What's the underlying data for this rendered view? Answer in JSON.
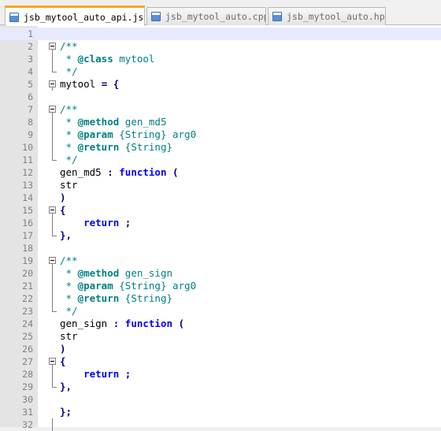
{
  "tabs": [
    {
      "label": "jsb_mytool_auto_api.js",
      "active": true,
      "close_icon": "close-icon"
    },
    {
      "label": "jsb_mytool_auto.cpp",
      "active": false
    },
    {
      "label": "jsb_mytool_auto.hpp",
      "active": false
    }
  ],
  "editor": {
    "current_line": 1,
    "lines": [
      {
        "n": "1",
        "fold": "",
        "tokens": [
          {
            "t": "",
            "c": ""
          }
        ]
      },
      {
        "n": "2",
        "fold": "open",
        "tokens": [
          {
            "t": "/**",
            "c": "c-comment"
          }
        ]
      },
      {
        "n": "3",
        "fold": "mid",
        "tokens": [
          {
            "t": " * ",
            "c": "c-comment"
          },
          {
            "t": "@class",
            "c": "c-tag"
          },
          {
            "t": " mytool",
            "c": "c-comment"
          }
        ]
      },
      {
        "n": "4",
        "fold": "end",
        "tokens": [
          {
            "t": " */",
            "c": "c-comment"
          }
        ]
      },
      {
        "n": "5",
        "fold": "open-solo",
        "tokens": [
          {
            "t": "mytool ",
            "c": ""
          },
          {
            "t": "=",
            "c": "c-op"
          },
          {
            "t": " ",
            "c": ""
          },
          {
            "t": "{",
            "c": "c-op"
          }
        ]
      },
      {
        "n": "6",
        "fold": "",
        "tokens": [
          {
            "t": "",
            "c": ""
          }
        ]
      },
      {
        "n": "7",
        "fold": "open",
        "tokens": [
          {
            "t": "/**",
            "c": "c-comment"
          }
        ]
      },
      {
        "n": "8",
        "fold": "mid",
        "tokens": [
          {
            "t": " * ",
            "c": "c-comment"
          },
          {
            "t": "@method",
            "c": "c-tag"
          },
          {
            "t": " gen_md5",
            "c": "c-comment"
          }
        ]
      },
      {
        "n": "9",
        "fold": "mid",
        "tokens": [
          {
            "t": " * ",
            "c": "c-comment"
          },
          {
            "t": "@param",
            "c": "c-tag"
          },
          {
            "t": " {String} arg0",
            "c": "c-comment"
          }
        ]
      },
      {
        "n": "10",
        "fold": "mid",
        "tokens": [
          {
            "t": " * ",
            "c": "c-comment"
          },
          {
            "t": "@return",
            "c": "c-tag"
          },
          {
            "t": " {String}",
            "c": "c-comment"
          }
        ]
      },
      {
        "n": "11",
        "fold": "end",
        "tokens": [
          {
            "t": " */",
            "c": "c-comment"
          }
        ]
      },
      {
        "n": "12",
        "fold": "",
        "tokens": [
          {
            "t": "gen_md5 ",
            "c": ""
          },
          {
            "t": ":",
            "c": "c-op"
          },
          {
            "t": " ",
            "c": ""
          },
          {
            "t": "function",
            "c": "c-kw"
          },
          {
            "t": " ",
            "c": ""
          },
          {
            "t": "(",
            "c": "c-op"
          }
        ]
      },
      {
        "n": "13",
        "fold": "",
        "tokens": [
          {
            "t": "str",
            "c": ""
          }
        ]
      },
      {
        "n": "14",
        "fold": "",
        "tokens": [
          {
            "t": ")",
            "c": "c-op"
          }
        ]
      },
      {
        "n": "15",
        "fold": "open",
        "tokens": [
          {
            "t": "{",
            "c": "c-op"
          }
        ]
      },
      {
        "n": "16",
        "fold": "mid",
        "tokens": [
          {
            "t": "    ",
            "c": ""
          },
          {
            "t": "return",
            "c": "c-kw"
          },
          {
            "t": " ",
            "c": ""
          },
          {
            "t": ";",
            "c": "c-op"
          }
        ]
      },
      {
        "n": "17",
        "fold": "end",
        "tokens": [
          {
            "t": "},",
            "c": "c-op"
          }
        ]
      },
      {
        "n": "18",
        "fold": "",
        "tokens": [
          {
            "t": "",
            "c": ""
          }
        ]
      },
      {
        "n": "19",
        "fold": "open",
        "tokens": [
          {
            "t": "/**",
            "c": "c-comment"
          }
        ]
      },
      {
        "n": "20",
        "fold": "mid",
        "tokens": [
          {
            "t": " * ",
            "c": "c-comment"
          },
          {
            "t": "@method",
            "c": "c-tag"
          },
          {
            "t": " gen_sign",
            "c": "c-comment"
          }
        ]
      },
      {
        "n": "21",
        "fold": "mid",
        "tokens": [
          {
            "t": " * ",
            "c": "c-comment"
          },
          {
            "t": "@param",
            "c": "c-tag"
          },
          {
            "t": " {String} arg0",
            "c": "c-comment"
          }
        ]
      },
      {
        "n": "22",
        "fold": "mid",
        "tokens": [
          {
            "t": " * ",
            "c": "c-comment"
          },
          {
            "t": "@return",
            "c": "c-tag"
          },
          {
            "t": " {String}",
            "c": "c-comment"
          }
        ]
      },
      {
        "n": "23",
        "fold": "end",
        "tokens": [
          {
            "t": " */",
            "c": "c-comment"
          }
        ]
      },
      {
        "n": "24",
        "fold": "",
        "tokens": [
          {
            "t": "gen_sign ",
            "c": ""
          },
          {
            "t": ":",
            "c": "c-op"
          },
          {
            "t": " ",
            "c": ""
          },
          {
            "t": "function",
            "c": "c-kw"
          },
          {
            "t": " ",
            "c": ""
          },
          {
            "t": "(",
            "c": "c-op"
          }
        ]
      },
      {
        "n": "25",
        "fold": "",
        "tokens": [
          {
            "t": "str",
            "c": ""
          }
        ]
      },
      {
        "n": "26",
        "fold": "",
        "tokens": [
          {
            "t": ")",
            "c": "c-op"
          }
        ]
      },
      {
        "n": "27",
        "fold": "open",
        "tokens": [
          {
            "t": "{",
            "c": "c-op"
          }
        ]
      },
      {
        "n": "28",
        "fold": "mid",
        "tokens": [
          {
            "t": "    ",
            "c": ""
          },
          {
            "t": "return",
            "c": "c-kw"
          },
          {
            "t": " ",
            "c": ""
          },
          {
            "t": ";",
            "c": "c-op"
          }
        ]
      },
      {
        "n": "29",
        "fold": "end",
        "tokens": [
          {
            "t": "},",
            "c": "c-op"
          }
        ]
      },
      {
        "n": "30",
        "fold": "",
        "tokens": [
          {
            "t": "",
            "c": ""
          }
        ]
      },
      {
        "n": "31",
        "fold": "",
        "tokens": [
          {
            "t": "};",
            "c": "c-op"
          }
        ]
      },
      {
        "n": "32",
        "fold": "tail",
        "tokens": [
          {
            "t": "",
            "c": ""
          }
        ]
      }
    ]
  },
  "colors": {
    "active_tab_accent": "#f5a623",
    "comment": "#008080",
    "keyword": "#0000ff",
    "operator": "#000080",
    "current_line": "#e8e8ff"
  }
}
